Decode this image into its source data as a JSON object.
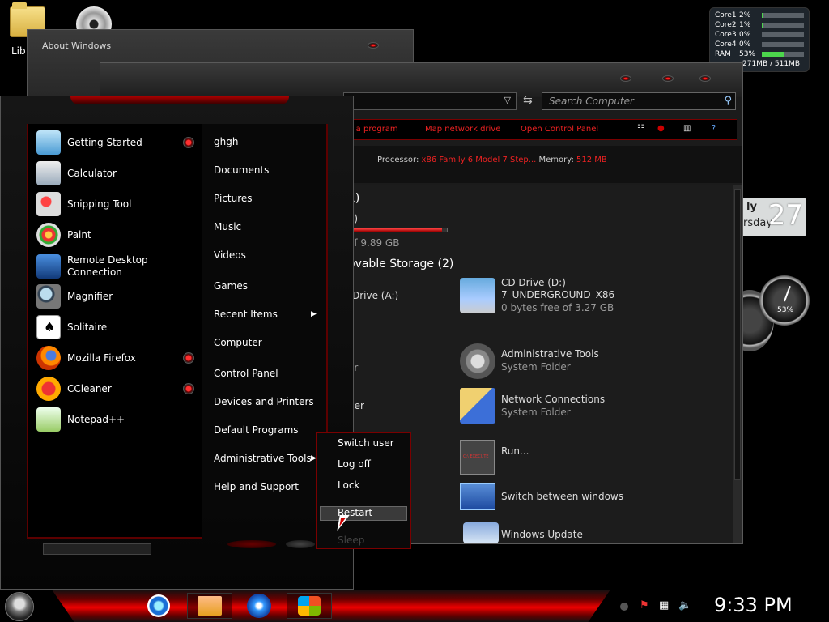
{
  "desktop": {
    "icons": [
      {
        "label": "Lib"
      },
      {
        "label": ""
      }
    ]
  },
  "cpu_gadget": {
    "rows": [
      {
        "label": "Core1",
        "value": "2%",
        "level": 0.02
      },
      {
        "label": "Core2",
        "value": "1%",
        "level": 0.01
      },
      {
        "label": "Core3",
        "value": "0%",
        "level": 0.0
      },
      {
        "label": "Core4",
        "value": "0%",
        "level": 0.0
      },
      {
        "label": "RAM",
        "value": "53%",
        "level": 0.53
      }
    ],
    "memory": "271MB / 511MB"
  },
  "calendar_gadget": {
    "month_fragment": "ly",
    "day_fragment": "rsday",
    "date": "27"
  },
  "gauge": {
    "value": "53%"
  },
  "about_window": {
    "title": "About Windows"
  },
  "computer_window": {
    "search_placeholder": "Search Computer",
    "commands": [
      "ge a program",
      "Map network drive",
      "Open Control Panel"
    ],
    "details": {
      "processor_label": "Processor:",
      "processor_value": "x86 Family 6 Model 7 Step...",
      "memory_label": "Memory:",
      "memory_value": "512 MB"
    },
    "content": {
      "hd_section_fragment": "1)",
      "hd_drive_fragment": "C:)",
      "hd_free_fragment": "of 9.89 GB",
      "hd_used_level": 0.95,
      "removable_header": "ovable Storage (2)",
      "floppy_fragment": "Drive (A:)",
      "cd_drive": {
        "name": "CD Drive (D:)",
        "label": "7_UNDERGROUND_X86",
        "free": "0 bytes free of 3.27 GB"
      },
      "left_fragment_1": "er",
      "left_fragment_2": "ger",
      "items": [
        {
          "name": "Administrative Tools",
          "sub": "System Folder"
        },
        {
          "name": "Network Connections",
          "sub": "System Folder"
        },
        {
          "name": "Run...",
          "sub": ""
        },
        {
          "name": "Switch between windows",
          "sub": ""
        },
        {
          "name": "Windows Update",
          "sub": ""
        }
      ]
    }
  },
  "start_menu": {
    "programs": [
      {
        "label": "Getting Started",
        "jump": true
      },
      {
        "label": "Calculator",
        "jump": false
      },
      {
        "label": "Snipping Tool",
        "jump": false
      },
      {
        "label": "Paint",
        "jump": false
      },
      {
        "label": "Remote Desktop Connection",
        "jump": false
      },
      {
        "label": "Magnifier",
        "jump": false
      },
      {
        "label": "Solitaire",
        "jump": false
      },
      {
        "label": "Mozilla Firefox",
        "jump": true
      },
      {
        "label": "CCleaner",
        "jump": true
      },
      {
        "label": "Notepad++",
        "jump": false
      }
    ],
    "places": [
      {
        "label": "ghgh"
      },
      {
        "label": "Documents"
      },
      {
        "label": "Pictures"
      },
      {
        "label": "Music"
      },
      {
        "label": "Videos"
      },
      {
        "label": "Games"
      },
      {
        "label": "Recent Items"
      },
      {
        "label": "Computer"
      },
      {
        "label": "Control Panel"
      },
      {
        "label": "Devices and Printers"
      },
      {
        "label": "Default Programs"
      },
      {
        "label": "Administrative Tools"
      },
      {
        "label": "Help and Support"
      }
    ]
  },
  "power_menu": {
    "items": [
      "Switch user",
      "Log off",
      "Lock",
      "Restart",
      "Sleep"
    ],
    "highlighted": "Restart",
    "disabled": "Sleep"
  },
  "taskbar": {
    "clock": "9:33 PM"
  }
}
